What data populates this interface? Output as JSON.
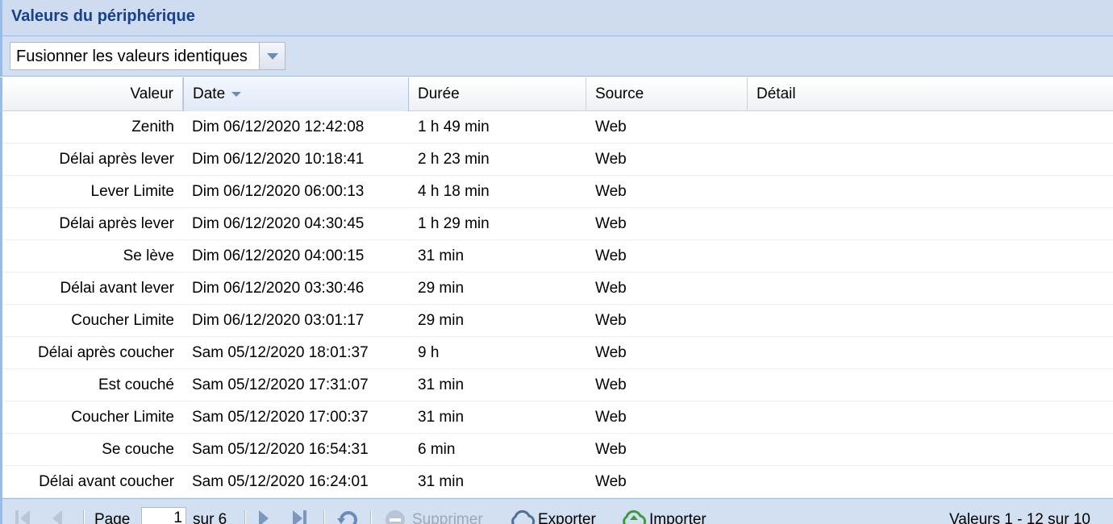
{
  "panel": {
    "title": "Valeurs du périphérique"
  },
  "toolbar": {
    "merge_select_value": "Fusionner les valeurs identiques"
  },
  "grid": {
    "columns": [
      {
        "label": "Valeur"
      },
      {
        "label": "Date"
      },
      {
        "label": "Durée"
      },
      {
        "label": "Source"
      },
      {
        "label": "Détail"
      }
    ],
    "rows": [
      {
        "valeur": "Zenith",
        "date": "Dim 06/12/2020 12:42:08",
        "duree": "1 h 49 min",
        "source": "Web",
        "detail": ""
      },
      {
        "valeur": "Délai après lever",
        "date": "Dim 06/12/2020 10:18:41",
        "duree": "2 h 23 min",
        "source": "Web",
        "detail": ""
      },
      {
        "valeur": "Lever Limite",
        "date": "Dim 06/12/2020 06:00:13",
        "duree": "4 h 18 min",
        "source": "Web",
        "detail": ""
      },
      {
        "valeur": "Délai après lever",
        "date": "Dim 06/12/2020 04:30:45",
        "duree": "1 h 29 min",
        "source": "Web",
        "detail": ""
      },
      {
        "valeur": "Se lève",
        "date": "Dim 06/12/2020 04:00:15",
        "duree": "31 min",
        "source": "Web",
        "detail": ""
      },
      {
        "valeur": "Délai avant lever",
        "date": "Dim 06/12/2020 03:30:46",
        "duree": "29 min",
        "source": "Web",
        "detail": ""
      },
      {
        "valeur": "Coucher Limite",
        "date": "Dim 06/12/2020 03:01:17",
        "duree": "29 min",
        "source": "Web",
        "detail": ""
      },
      {
        "valeur": "Délai après coucher",
        "date": "Sam 05/12/2020 18:01:37",
        "duree": "9 h",
        "source": "Web",
        "detail": ""
      },
      {
        "valeur": "Est couché",
        "date": "Sam 05/12/2020 17:31:07",
        "duree": "31 min",
        "source": "Web",
        "detail": ""
      },
      {
        "valeur": "Coucher Limite",
        "date": "Sam 05/12/2020 17:00:37",
        "duree": "31 min",
        "source": "Web",
        "detail": ""
      },
      {
        "valeur": "Se couche",
        "date": "Sam 05/12/2020 16:54:31",
        "duree": "6 min",
        "source": "Web",
        "detail": ""
      },
      {
        "valeur": "Délai avant coucher",
        "date": "Sam 05/12/2020 16:24:01",
        "duree": "31 min",
        "source": "Web",
        "detail": ""
      }
    ]
  },
  "paging": {
    "page_label": "Page",
    "page_value": "1",
    "of_label": "sur 6",
    "delete_label": "Supprimer",
    "export_label": "Exporter",
    "import_label": "Importer",
    "summary": "Valeurs 1 - 12 sur 10"
  },
  "colors": {
    "header_text": "#15428b",
    "panel_bg": "#cfdbef",
    "border": "#99bbe8"
  }
}
